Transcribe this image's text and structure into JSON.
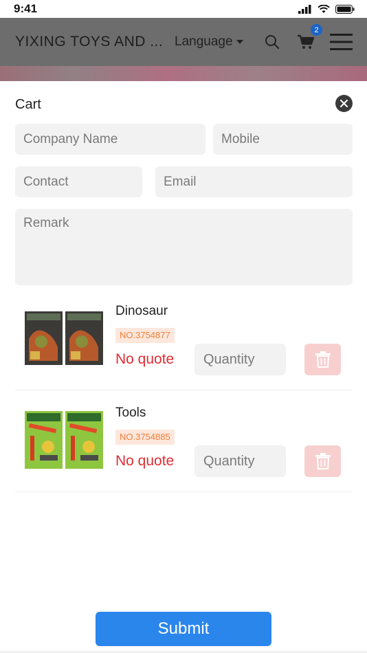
{
  "status_bar": {
    "time": "9:41"
  },
  "header": {
    "title": "YIXING TOYS AND ...",
    "language_label": "Language",
    "cart_count": "2",
    "icons": [
      "search-icon",
      "cart-icon",
      "menu-icon"
    ]
  },
  "cart": {
    "title": "Cart",
    "form": {
      "company_name": {
        "placeholder": "Company Name",
        "value": ""
      },
      "mobile": {
        "placeholder": "Mobile",
        "value": ""
      },
      "contact": {
        "placeholder": "Contact",
        "value": ""
      },
      "email": {
        "placeholder": "Email",
        "value": ""
      },
      "remark": {
        "placeholder": "Remark",
        "value": ""
      }
    },
    "items": [
      {
        "name": "Dinosaur",
        "code": "NO.3754877",
        "quote": "No quote",
        "quantity_placeholder": "Quantity"
      },
      {
        "name": "Tools",
        "code": "NO.3754885",
        "quote": "No quote",
        "quantity_placeholder": "Quantity"
      }
    ],
    "submit_label": "Submit"
  },
  "colors": {
    "accent": "#2b86ec",
    "price": "#e02c33",
    "code_text": "#f0803c",
    "code_bg": "#fde7dc",
    "delete_bg": "#f7cfcf"
  }
}
